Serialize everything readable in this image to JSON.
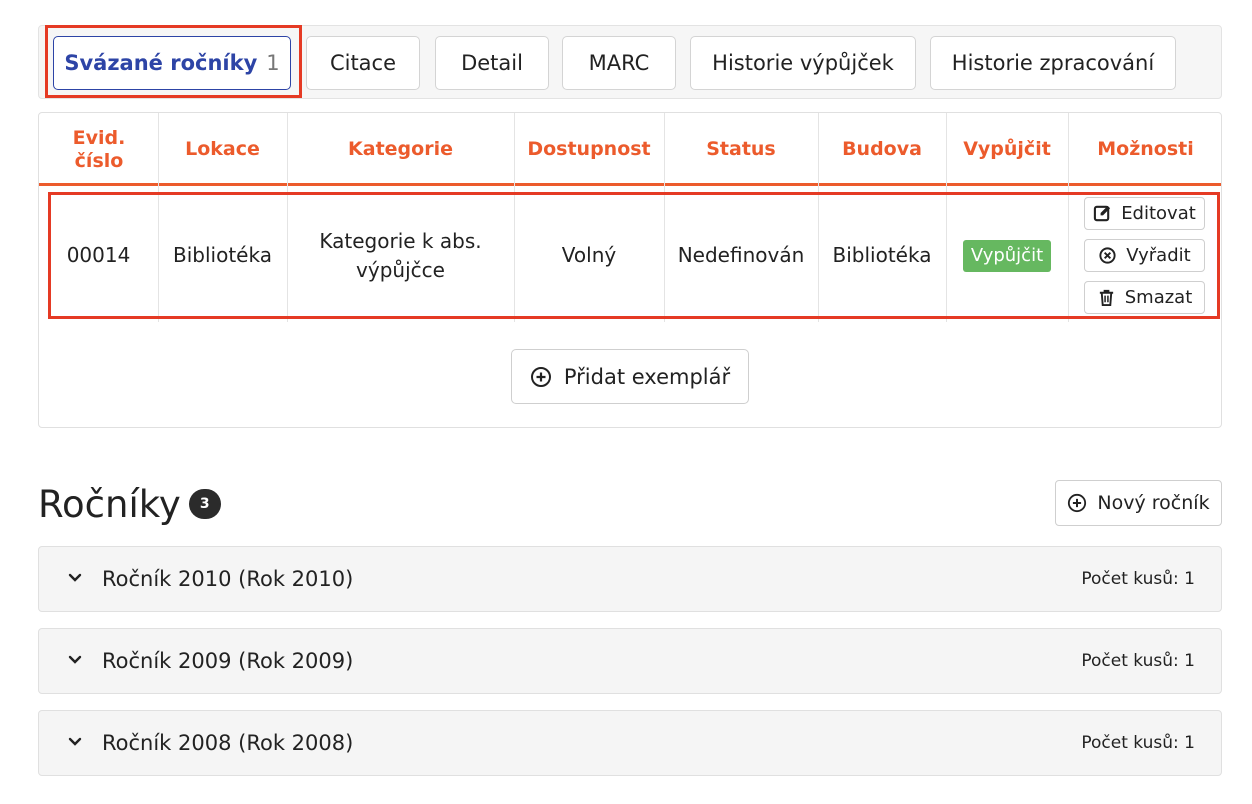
{
  "tabs": [
    {
      "label": "Svázané ročníky",
      "count": "1"
    },
    {
      "label": "Citace"
    },
    {
      "label": "Detail"
    },
    {
      "label": "MARC"
    },
    {
      "label": "Historie výpůjček"
    },
    {
      "label": "Historie zpracování"
    }
  ],
  "table": {
    "headers": [
      "Evid. číslo",
      "Lokace",
      "Kategorie",
      "Dostupnost",
      "Status",
      "Budova",
      "Vypůjčit",
      "Možnosti"
    ],
    "row": {
      "evid": "00014",
      "lokace": "Bibliotéka",
      "kategorie": "Kategorie k abs. výpůjčce",
      "dostupnost": "Volný",
      "status": "Nedefinován",
      "budova": "Bibliotéka",
      "vypujcit_btn": "Vypůjčit",
      "options": {
        "edit": "Editovat",
        "discard": "Vyřadit",
        "delete": "Smazat"
      }
    },
    "add_button": "Přidat exemplář"
  },
  "volumes": {
    "title": "Ročníky",
    "count": "3",
    "new_button": "Nový ročník",
    "items": [
      {
        "title": "Ročník 2010 (Rok 2010)",
        "count_text": "Počet kusů: 1"
      },
      {
        "title": "Ročník 2009 (Rok 2009)",
        "count_text": "Počet kusů: 1"
      },
      {
        "title": "Ročník 2008 (Rok 2008)",
        "count_text": "Počet kusů: 1"
      }
    ]
  },
  "colors": {
    "accent": "#ec5b2c",
    "active_tab": "#2d44a6",
    "highlight": "#e53a24",
    "success": "#66b860"
  }
}
